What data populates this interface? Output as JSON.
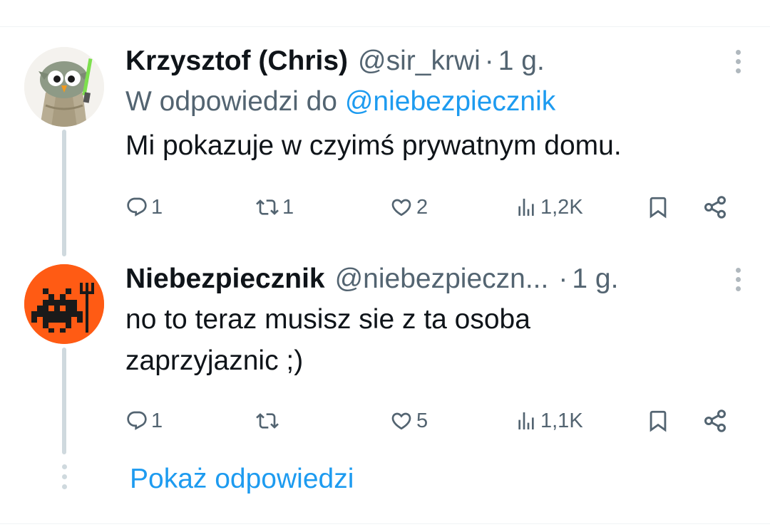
{
  "tweets": [
    {
      "name": "Krzysztof (Chris)",
      "handle": "@sir_krwi",
      "separator": "·",
      "time": "1 g.",
      "reply_prefix": "W odpowiedzi do ",
      "reply_handle": "@niebezpiecznik",
      "text": "Mi pokazuje w czyimś prywatnym domu.",
      "replies": "1",
      "retweets": "1",
      "likes": "2",
      "views": "1,2K",
      "avatar_icon": "owl-jedi-avatar"
    },
    {
      "name": "Niebezpiecznik",
      "handle": "@niebezpieczn...",
      "separator": "·",
      "time": "1 g.",
      "text": "no to teraz musisz sie z ta osoba\nzaprzyjaznic ;)",
      "replies": "1",
      "retweets": "",
      "likes": "5",
      "views": "1,1K",
      "avatar_icon": "pixel-devil-avatar"
    }
  ],
  "show_replies": "Pokaż odpowiedzi",
  "icons": [
    "reply-icon",
    "retweet-icon",
    "like-icon",
    "views-icon",
    "bookmark-icon",
    "share-icon",
    "more-icon"
  ],
  "colors": {
    "text": "#0f1419",
    "secondary": "#536471",
    "link": "#1d9bf0",
    "thread_line": "#cfd9de",
    "avatar2_bg": "#ff5b14"
  }
}
